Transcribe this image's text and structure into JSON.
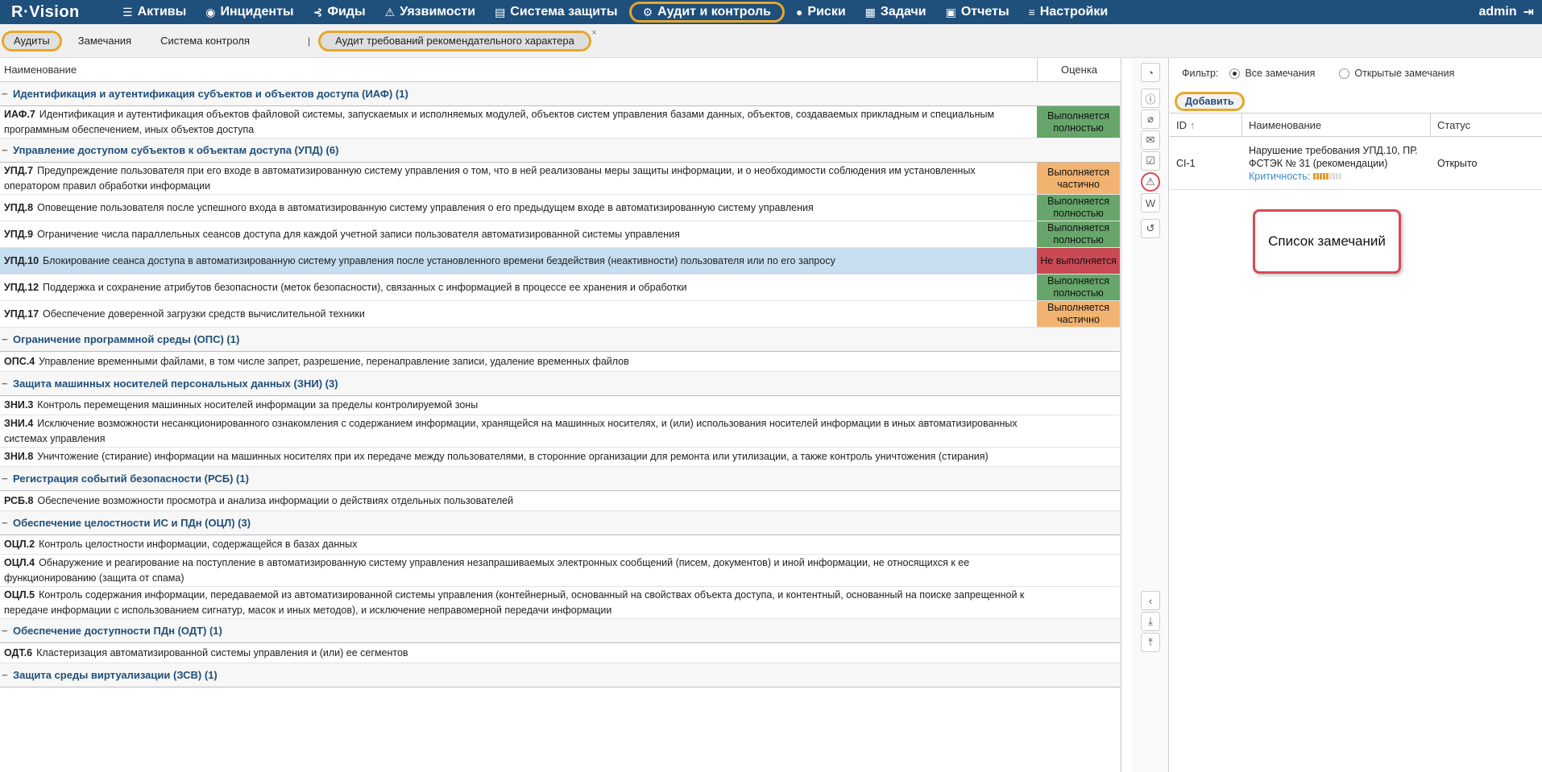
{
  "nav": {
    "logo": "R·Vision",
    "items": [
      {
        "label": "Активы",
        "icon": "database-icon",
        "glyph": "☰"
      },
      {
        "label": "Инциденты",
        "icon": "target-icon",
        "glyph": "◉"
      },
      {
        "label": "Фиды",
        "icon": "rss-icon",
        "glyph": "⊰"
      },
      {
        "label": "Уязвимости",
        "icon": "warning-icon",
        "glyph": "⚠"
      },
      {
        "label": "Система защиты",
        "icon": "server-icon",
        "glyph": "▤"
      },
      {
        "label": "Аудит и контроль",
        "icon": "gear-icon",
        "glyph": "⚙"
      },
      {
        "label": "Риски",
        "icon": "alert-icon",
        "glyph": "●"
      },
      {
        "label": "Задачи",
        "icon": "tasks-icon",
        "glyph": "▦"
      },
      {
        "label": "Отчеты",
        "icon": "reports-icon",
        "glyph": "▣"
      },
      {
        "label": "Настройки",
        "icon": "menu-icon",
        "glyph": "≡"
      }
    ],
    "user": "admin"
  },
  "subtabs": {
    "audits": "Аудиты",
    "remarks": "Замечания",
    "control": "Система контроля",
    "sep": "|",
    "audit_tab": "Аудит требований рекомендательного характера",
    "close": "×"
  },
  "table": {
    "col_name": "Наименование",
    "col_score": "Оценка"
  },
  "groups": [
    {
      "title": "Идентификация и аутентификация субъектов и объектов доступа (ИАФ) (1)",
      "rows": [
        {
          "code": "ИАФ.7",
          "text": "Идентификация и аутентификация объектов файловой системы, запускаемых и исполняемых модулей, объектов систем управления базами данных, объектов, создаваемых прикладным и специальным программным обеспечением, иных объектов доступа",
          "score": "Выполняется полностью",
          "status": "full",
          "h": 40
        }
      ]
    },
    {
      "title": "Управление доступом субъектов к объектам доступа (УПД) (6)",
      "rows": [
        {
          "code": "УПД.7",
          "text": "Предупреждение пользователя при его входе в автоматизированную систему управления о том, что в ней реализованы меры защиты информации, и о необходимости соблюдения им установленных оператором правил обработки информации",
          "score": "Выполняется частично",
          "status": "part",
          "h": 40
        },
        {
          "code": "УПД.8",
          "text": "Оповещение пользователя после успешного входа в автоматизированную систему управления о его предыдущем входе в автоматизированную систему управления",
          "score": "Выполняется полностью",
          "status": "full",
          "h": 33
        },
        {
          "code": "УПД.9",
          "text": "Ограничение числа параллельных сеансов доступа для каждой учетной записи пользователя автоматизированной системы управления",
          "score": "Выполняется полностью",
          "status": "full",
          "h": 33
        },
        {
          "code": "УПД.10",
          "text": "Блокирование сеанса доступа в автоматизированную систему управления после установленного времени бездействия (неактивности) пользователя или по его запросу",
          "score": "Не выполняется",
          "status": "no",
          "h": 33,
          "selected": true
        },
        {
          "code": "УПД.12",
          "text": "Поддержка и сохранение атрибутов безопасности (меток безопасности), связанных с информацией в процессе ее хранения и обработки",
          "score": "Выполняется полностью",
          "status": "full",
          "h": 33
        },
        {
          "code": "УПД.17",
          "text": "Обеспечение доверенной загрузки средств вычислительной техники",
          "score": "Выполняется частично",
          "status": "part",
          "h": 33
        }
      ]
    },
    {
      "title": "Ограничение программной среды (ОПС) (1)",
      "rows": [
        {
          "code": "ОПС.4",
          "text": "Управление временными файлами, в том числе запрет, разрешение, перенаправление записи, удаление временных файлов",
          "score": "",
          "status": "",
          "h": 25
        }
      ]
    },
    {
      "title": "Защита машинных носителей персональных данных (ЗНИ) (3)",
      "rows": [
        {
          "code": "ЗНИ.3",
          "text": "Контроль перемещения машинных носителей информации за пределы контролируемой зоны",
          "score": "",
          "status": "",
          "h": 24
        },
        {
          "code": "ЗНИ.4",
          "text": "Исключение возможности несанкционированного ознакомления с содержанием информации, хранящейся на машинных носителях, и (или) использования носителей информации в иных автоматизированных системах управления",
          "score": "",
          "status": "",
          "h": 40
        },
        {
          "code": "ЗНИ.8",
          "text": "Уничтожение (стирание) информации на машинных носителях при их передаче между пользователями, в сторонние организации для ремонта или утилизации, а также контроль уничтожения (стирания)",
          "score": "",
          "status": "",
          "h": 24
        }
      ]
    },
    {
      "title": "Регистрация событий безопасности (РСБ) (1)",
      "rows": [
        {
          "code": "РСБ.8",
          "text": "Обеспечение возможности просмотра и анализа информации о действиях отдельных пользователей",
          "score": "",
          "status": "",
          "h": 25
        }
      ]
    },
    {
      "title": "Обеспечение целостности ИС и ПДн (ОЦЛ) (3)",
      "rows": [
        {
          "code": "ОЦЛ.2",
          "text": "Контроль целостности информации, содержащейся в базах данных",
          "score": "",
          "status": "",
          "h": 24
        },
        {
          "code": "ОЦЛ.4",
          "text": "Обнаружение и реагирование на поступление в   автоматизированную систему управления незапрашиваемых электронных сообщений (писем, документов) и иной информации, не относящихся к ее функционированию (защита от спама)",
          "score": "",
          "status": "",
          "h": 40
        },
        {
          "code": "ОЦЛ.5",
          "text": "Контроль содержания информации, передаваемой из автоматизированной системы управления (контейнерный, основанный на свойствах объекта доступа, и контентный, основанный на поиске запрещенной к передаче информации с использованием сигнатур, масок и иных методов), и исключение неправомерной передачи информации",
          "score": "",
          "status": "",
          "h": 40
        }
      ]
    },
    {
      "title": "Обеспечение доступности ПДн (ОДТ) (1)",
      "rows": [
        {
          "code": "ОДТ.6",
          "text": "Кластеризация автоматизированной системы управления и (или) ее сегментов",
          "score": "",
          "status": "",
          "h": 25
        }
      ]
    },
    {
      "title": "Защита среды виртуализации (ЗСВ) (1)",
      "rows": []
    }
  ],
  "strip": [
    {
      "icon": "pie-chart-icon",
      "glyph": "◔"
    },
    {
      "icon": "info-icon",
      "glyph": "ⓘ"
    },
    {
      "icon": "paperclip-icon",
      "glyph": "⌀"
    },
    {
      "icon": "comments-icon",
      "glyph": "✉"
    },
    {
      "icon": "checklist-icon",
      "glyph": "☑"
    },
    {
      "icon": "warning-icon",
      "glyph": "⚠"
    },
    {
      "icon": "word-icon",
      "glyph": "W"
    },
    {
      "icon": "history-icon",
      "glyph": "↺"
    }
  ],
  "strip_bottom": [
    {
      "icon": "chevron-left-icon",
      "glyph": "‹"
    },
    {
      "icon": "export-icon",
      "glyph": "⤓"
    },
    {
      "icon": "import-icon",
      "glyph": "⤒"
    }
  ],
  "remarks": {
    "filter_label": "Фильтр:",
    "opt_all": "Все замечания",
    "opt_open": "Открытые замечания",
    "add": "Добавить",
    "col_id": "ID",
    "sort": "↑",
    "col_name": "Наименование",
    "col_status": "Статус",
    "items": [
      {
        "id": "CI-1",
        "name": "Нарушение требования УПД.10, ПР. ФСТЭК № 31 (рекомендации)",
        "crit_label": "Критичность:",
        "crit_level": 5,
        "crit_max": 9,
        "status": "Открыто"
      }
    ],
    "annotation": "Список замечаний"
  }
}
